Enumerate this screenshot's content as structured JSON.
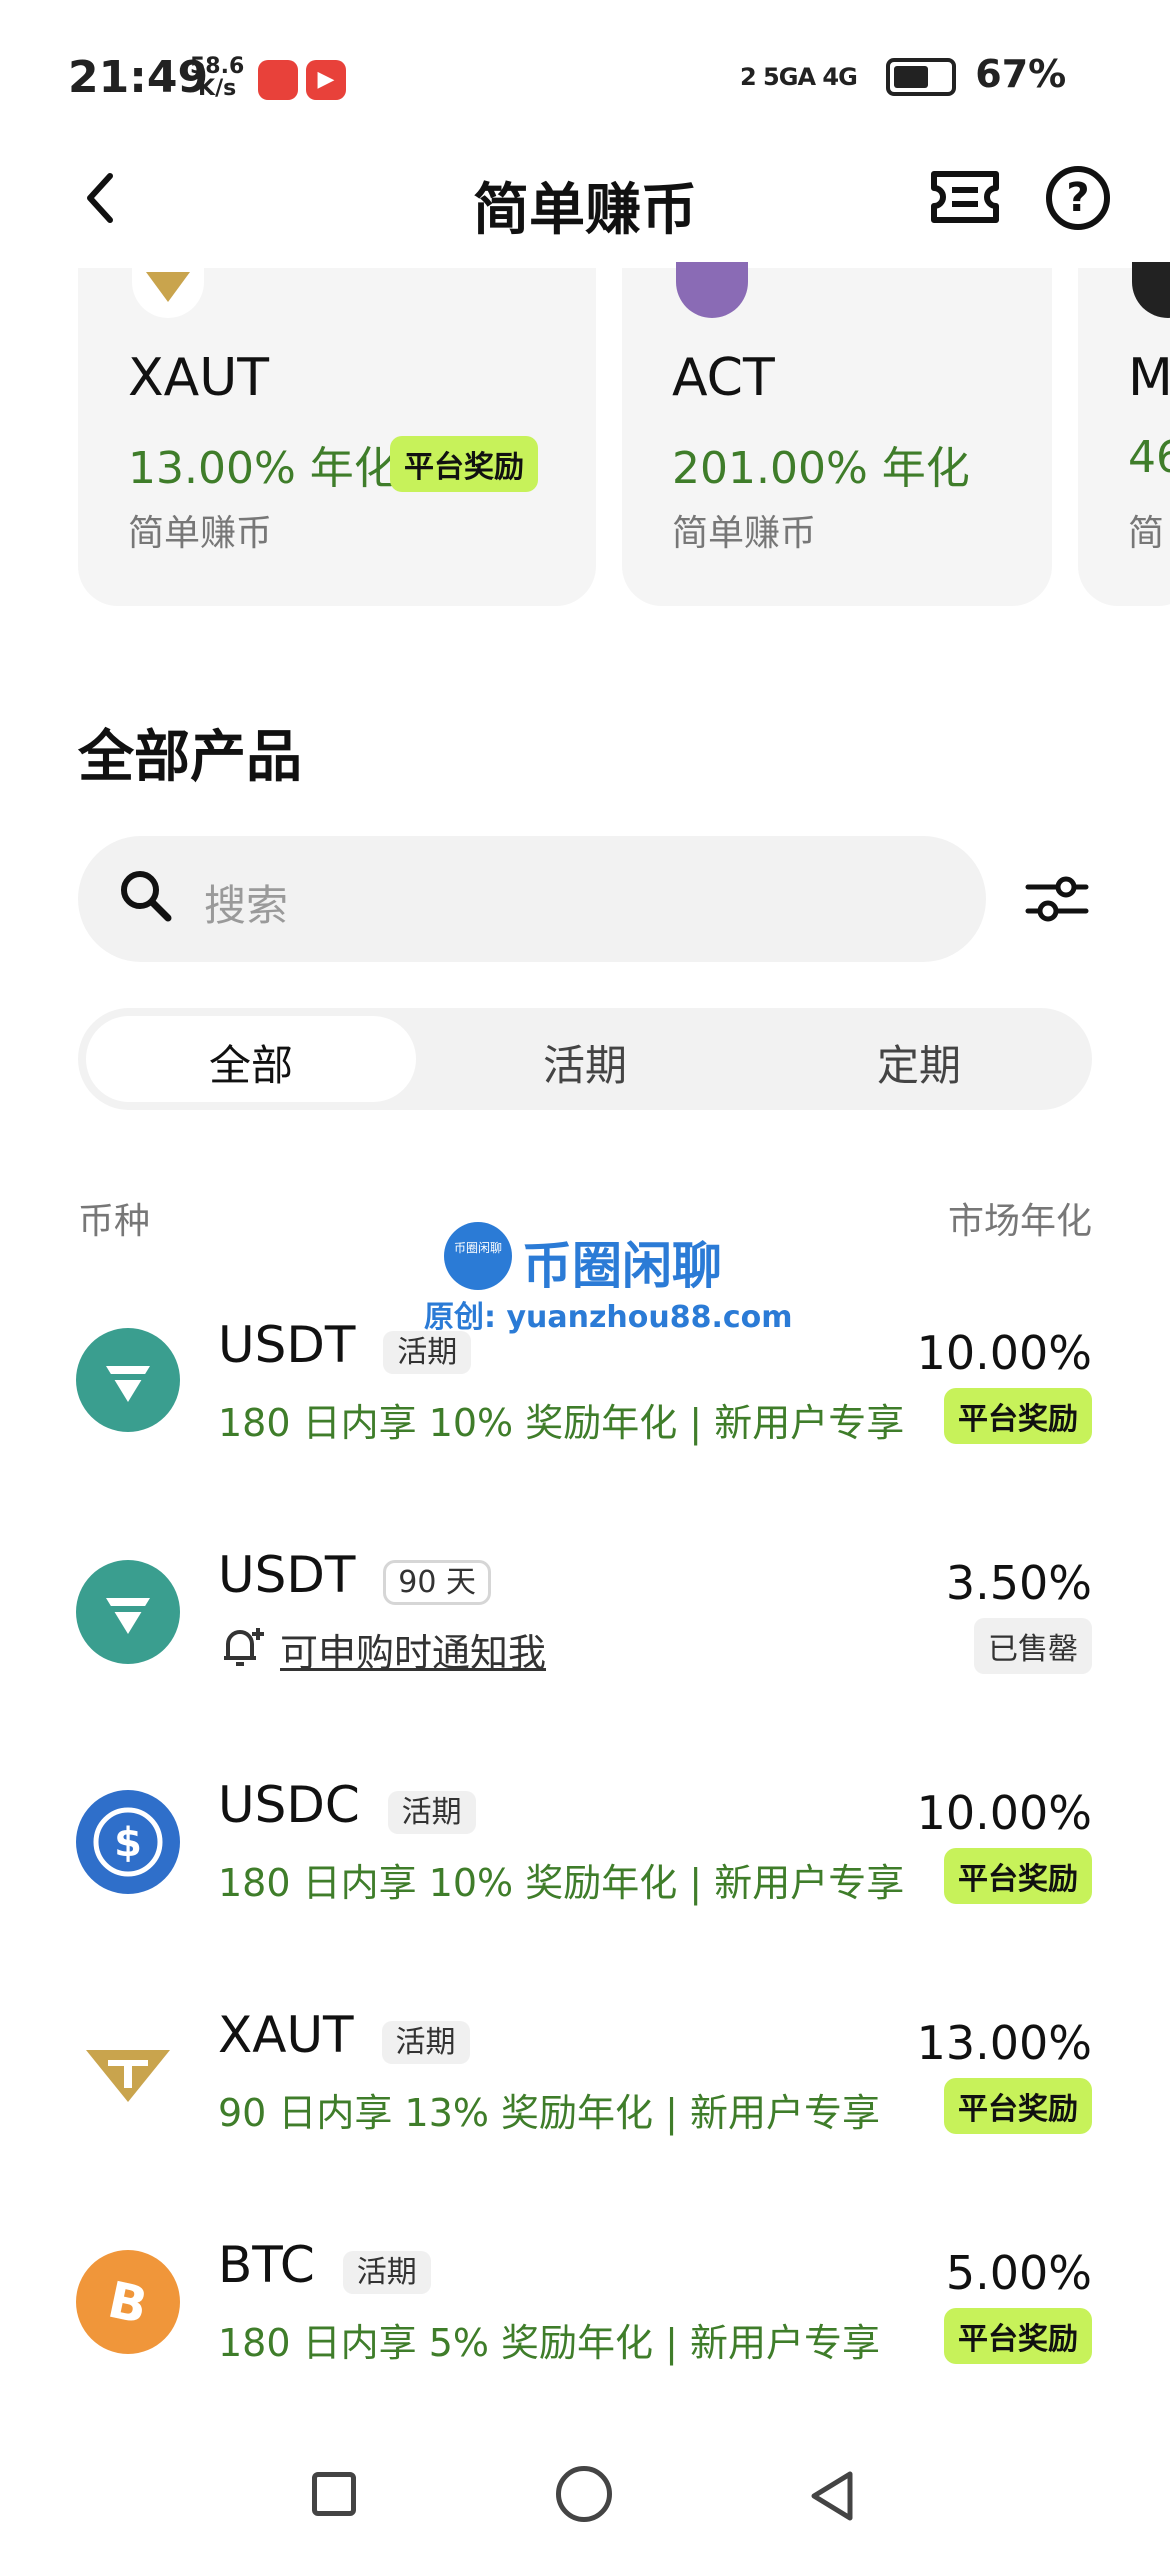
{
  "status_bar": {
    "time": "21:49",
    "net_speed_value": "58.6",
    "net_speed_unit": "K/s",
    "network": "2 5GA  4G",
    "battery": "67%"
  },
  "header": {
    "title": "简单赚币",
    "back_icon": "chevron-left-icon",
    "ticket_icon": "ticket-icon",
    "help_icon": "question-circle-icon"
  },
  "featured": [
    {
      "name": "XAUT",
      "apr": "13.00% 年化",
      "badge": "平台奖励",
      "sub": "简单赚币"
    },
    {
      "name": "ACT",
      "apr": "201.00% 年化",
      "sub": "简单赚币"
    },
    {
      "name": "M",
      "apr": "46",
      "sub": "简"
    }
  ],
  "section": {
    "title": "全部产品",
    "search_placeholder": "搜索"
  },
  "tabs": [
    "全部",
    "活期",
    "定期"
  ],
  "columns": {
    "left": "币种",
    "right": "市场年化"
  },
  "watermark": {
    "logo_text": "币圈闲聊",
    "title": "币圈闲聊",
    "sub": "原创: yuanzhou88.com"
  },
  "products": [
    {
      "coin": "USDT",
      "tag": "活期",
      "desc": "180 日内享 10% 奖励年化 | 新用户专享",
      "apr": "10.00%",
      "badge": "平台奖励",
      "color": "#3a9e8f"
    },
    {
      "coin": "USDT",
      "tag": "90 天",
      "notify": "可申购时通知我",
      "apr": "3.50%",
      "status": "已售罄",
      "color": "#3a9e8f"
    },
    {
      "coin": "USDC",
      "tag": "活期",
      "desc": "180 日内享 10% 奖励年化 | 新用户专享",
      "apr": "10.00%",
      "badge": "平台奖励",
      "color": "#2f6fca"
    },
    {
      "coin": "XAUT",
      "tag": "活期",
      "desc": "90 日内享 13% 奖励年化 | 新用户专享",
      "apr": "13.00%",
      "badge": "平台奖励",
      "color": "#c9a44d"
    },
    {
      "coin": "BTC",
      "tag": "活期",
      "desc": "180 日内享 5% 奖励年化 | 新用户专享",
      "apr": "5.00%",
      "badge": "平台奖励",
      "color": "#f0963a"
    }
  ]
}
